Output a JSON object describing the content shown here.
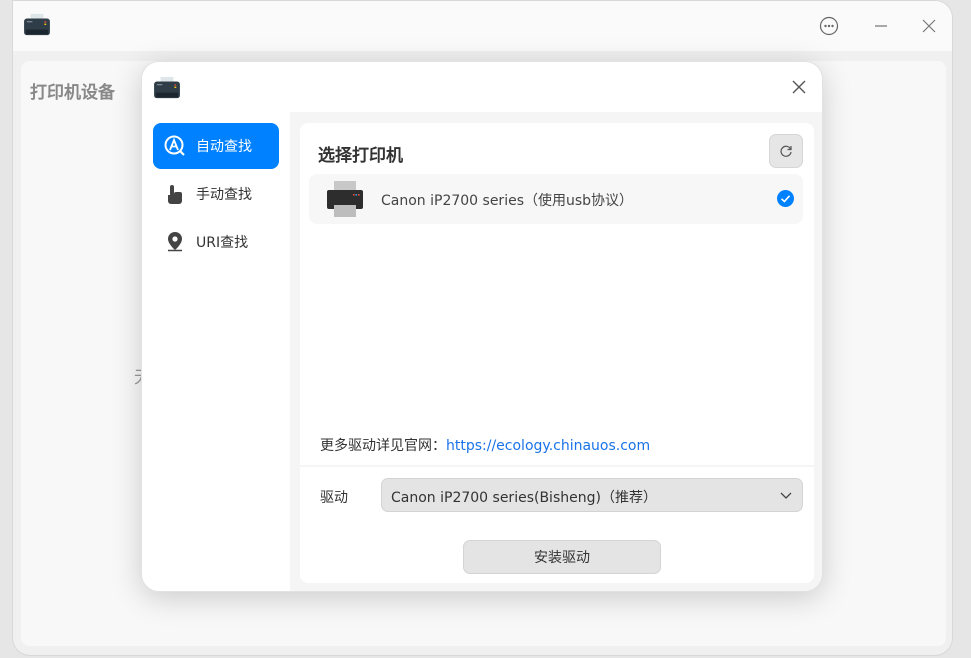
{
  "app": {
    "title_icon": "printer-icon",
    "menu_icon": "more-icon",
    "minimize_icon": "minimize-icon",
    "close_icon": "close-icon"
  },
  "background": {
    "title": "打印机设备",
    "hint": "无"
  },
  "dialog": {
    "nav": [
      {
        "label": "自动查找",
        "icon": "auto-search-icon",
        "active": true
      },
      {
        "label": "手动查找",
        "icon": "hand-pointer-icon",
        "active": false
      },
      {
        "label": "URI查找",
        "icon": "location-pin-icon",
        "active": false
      }
    ],
    "section_title": "选择打印机",
    "printers": [
      {
        "name": "Canon iP2700 series（使用usb协议）",
        "selected": true
      }
    ],
    "more_drivers_label": "更多驱动详见官网：",
    "more_drivers_link": "https://ecology.chinauos.com",
    "driver_label": "驱动",
    "driver_selected": "Canon iP2700 series(Bisheng)（推荐）",
    "install_button": "安装驱动"
  },
  "colors": {
    "accent": "#0081ff",
    "link": "#1a73e8"
  }
}
